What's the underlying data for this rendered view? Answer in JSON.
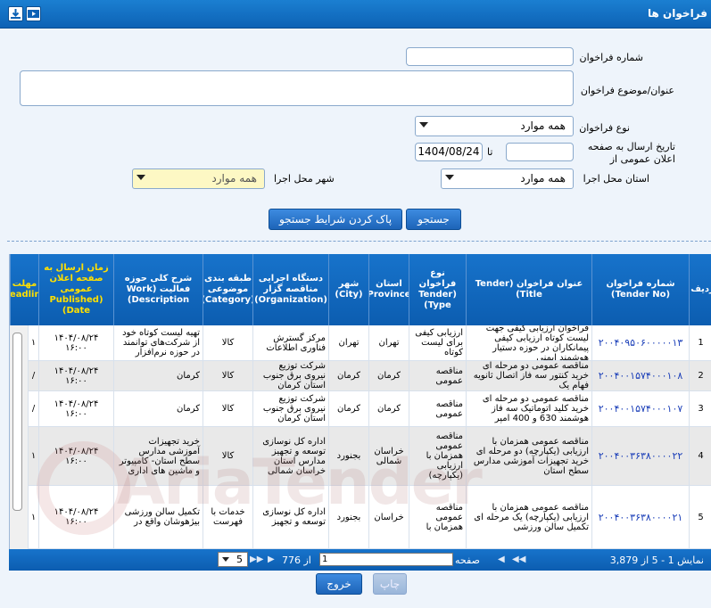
{
  "window": {
    "title": "فراخوان ها"
  },
  "toolbar_icons": [
    "video-icon",
    "download-icon"
  ],
  "form": {
    "tender_no_label": "شماره فراخوان",
    "tender_no_value": "",
    "subject_label": "عنوان/موضوع فراخوان",
    "subject_value": "",
    "type_label": "نوع فراخوان",
    "type_value": "همه موارد",
    "date_label": "تاریخ ارسال به صفحه اعلان عمومی از",
    "date_from": "",
    "date_to_label": "تا",
    "date_to": "1404/08/24",
    "province_label": "استان محل اجرا",
    "province_value": "همه موارد",
    "city_label": "شهر محل اجرا",
    "city_value": "همه موارد",
    "search_button": "جستجو",
    "clear_button": "پاک کردن شرایط جستجو"
  },
  "table": {
    "headers": {
      "row": "ردیف",
      "tender_no": "شماره فراخوان (Tender No)",
      "title": "عنوان فراخوان (Tender Title)",
      "type": "نوع فراخوان (Tender Type)",
      "province": "استان (Province)",
      "city": "شهر (City)",
      "org": "دستگاه اجرایی مناقصه گزار (Organization)",
      "category": "طبقه بندی موضوعی (Category)",
      "description": "شرح کلی حوزه فعالیت (Work Description)",
      "published": "زمان ارسال به صفحه اعلان عمومی (Published Date)",
      "deadline": "مهلت (Deadline)"
    },
    "rows": [
      {
        "row": "1",
        "tender_no": "۲۰۰۴۰۹۵۰۶۰۰۰۰۰۱۳",
        "title": "فراخوان ارزیابی کیفی جهت لیست کوتاه ارزیابی کیفی پیمانکاران در حوزه دستیار هوشمند ایمنی",
        "type": "ارزیابی کیفی برای لیست کوتاه",
        "province": "تهران",
        "city": "تهران",
        "org": "مرکز گسترش فناوری اطلاعات",
        "category": "کالا",
        "description": "تهیه لیست کوتاه خود از شرکت‌های توانمند در حوزه نرم‌افزار",
        "published": "۱۴۰۴/۰۸/۲۴ ۱۶:۰۰",
        "deadline": "۱"
      },
      {
        "row": "2",
        "tender_no": "۲۰۰۴۰۰۱۵۷۴۰۰۰۱۰۸",
        "title": "مناقصه عمومی دو مرحله ای خرید کنتور سه فاز اتصال ثانویه فهام یک",
        "type": "مناقصه عمومی",
        "province": "کرمان",
        "city": "کرمان",
        "org": "شرکت توزیع نیروی برق جنوب استان کرمان",
        "category": "کالا",
        "description": "کرمان",
        "published": "۱۴۰۴/۰۸/۲۴ ۱۶:۰۰",
        "deadline": "/"
      },
      {
        "row": "3",
        "tender_no": "۲۰۰۴۰۰۱۵۷۴۰۰۰۱۰۷",
        "title": "مناقصه عمومی دو مرحله ای خرید کلید اتوماتیک سه فاز هوشمند 630 و 400 امپر",
        "type": "مناقصه عمومی",
        "province": "کرمان",
        "city": "کرمان",
        "org": "شرکت توزیع نیروی برق جنوب استان کرمان",
        "category": "کالا",
        "description": "کرمان",
        "published": "۱۴۰۴/۰۸/۲۴ ۱۶:۰۰",
        "deadline": "/"
      },
      {
        "row": "4",
        "tender_no": "۲۰۰۴۰۰۳۶۳۸۰۰۰۰۲۲",
        "title": "مناقصه عمومی همزمان با ارزیابی (یکپارچه) دو مرحله ای خرید تجهیزات آموزشی مدارس سطح استان",
        "type": "مناقصه عمومی همزمان با ارزیابی (یکپارچه)",
        "province": "خراسان شمالی",
        "city": "بجنورد",
        "org": "اداره کل نوسازی توسعه و تجهیز مدارس استان خراسان شمالی",
        "category": "کالا",
        "description": "خرید تجهیزات آموزشی مدارس سطح استان- کامپیوتر و ماشین های اداری",
        "published": "۱۴۰۴/۰۸/۲۴ ۱۶:۰۰",
        "deadline": "۱"
      },
      {
        "row": "5",
        "tender_no": "۲۰۰۴۰۰۳۶۳۸۰۰۰۰۲۱",
        "title": "مناقصه عمومی همزمان با ارزیابی (یکپارچه) یک مرحله ای تکمیل سالن ورزشی",
        "type": "مناقصه عمومی همزمان با",
        "province": "خراسان",
        "city": "بجنورد",
        "org": "اداره کل نوسازی توسعه و تجهیز",
        "category": "خدمات با فهرست",
        "description": "تکمیل سالن ورزشی بیژهوشان واقع در",
        "published": "۱۴۰۴/۰۸/۲۴ ۱۶:۰۰",
        "deadline": "۱"
      }
    ]
  },
  "pager": {
    "summary": "نمایش 1 - 5 از 3,879",
    "page_label": "صفحه",
    "page_value": "1",
    "of_label": "از 776",
    "page_size": "5"
  },
  "footer": {
    "print_button": "چاپ",
    "exit_button": "خروج"
  },
  "watermark": "AriaTender"
}
